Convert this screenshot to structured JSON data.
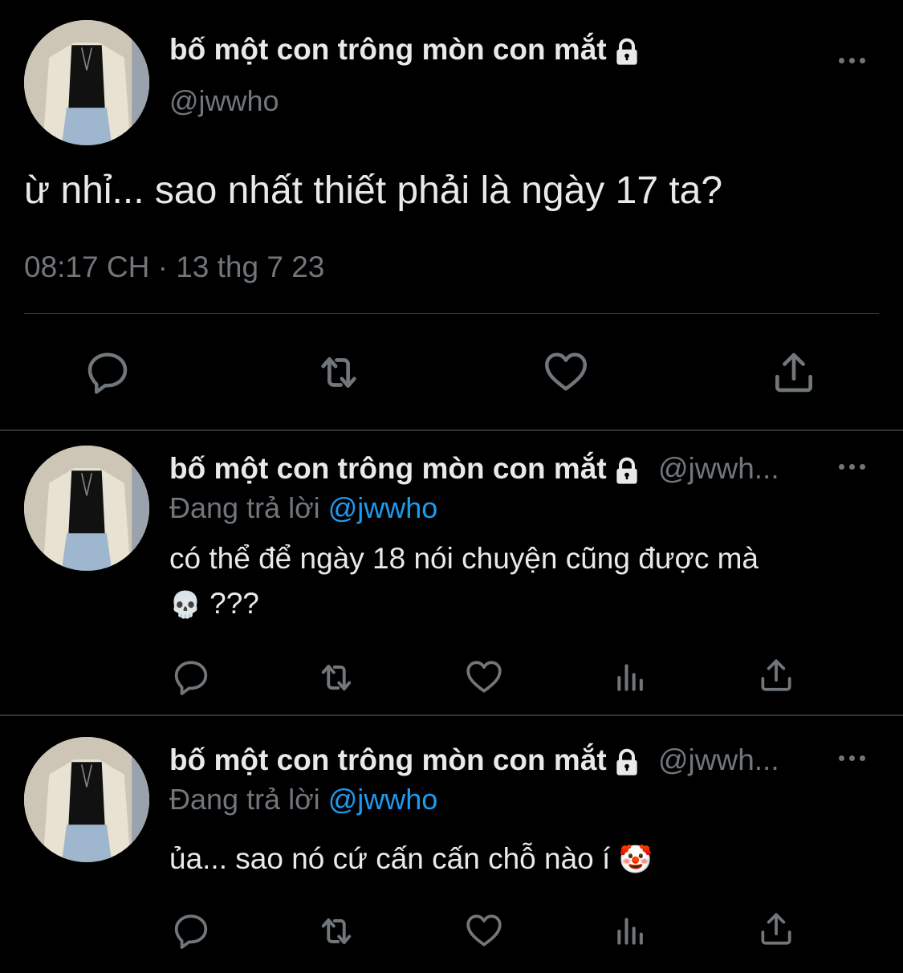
{
  "main_tweet": {
    "display_name": "bố một con trông mòn con mắt",
    "handle": "@jwwho",
    "text": "ừ nhỉ... sao nhất thiết phải là ngày 17 ta?",
    "timestamp": "08:17 CH · 13 thg 7 23"
  },
  "replies": [
    {
      "display_name": "bố một con trông mòn con mắt",
      "handle_truncated": "@jwwh...",
      "replying_prefix": "Đang trả lời",
      "replying_to": "@jwwho",
      "text_line1": "có thể để ngày 18 nói chuyện cũng được mà",
      "emoji": "💀",
      "text_line2": "???"
    },
    {
      "display_name": "bố một con trông mòn con mắt",
      "handle_truncated": "@jwwh...",
      "replying_prefix": "Đang trả lời",
      "replying_to": "@jwwho",
      "text_line1": "ủa... sao nó cứ cấn cấn chỗ nào í",
      "emoji": "🤡"
    }
  ],
  "icons": {
    "reply": "reply-icon",
    "retweet": "retweet-icon",
    "like": "heart-icon",
    "views": "views-icon",
    "share": "share-icon",
    "more": "more-icon",
    "lock": "lock-icon"
  },
  "colors": {
    "background": "#000000",
    "text": "#e7e9ea",
    "muted": "#71767b",
    "link": "#1d9bf0",
    "divider": "#2f3336"
  }
}
